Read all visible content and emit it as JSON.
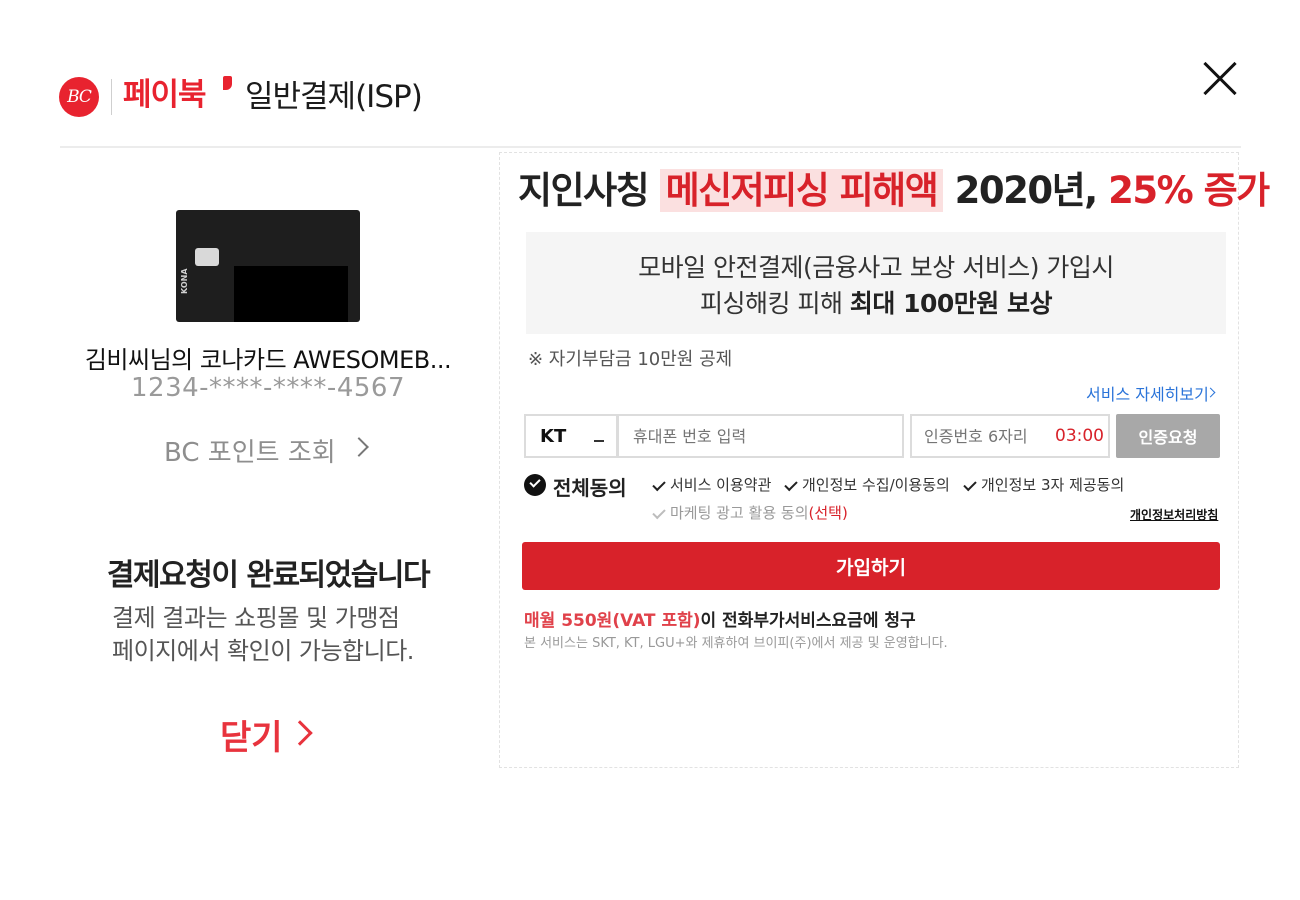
{
  "header": {
    "logo_text": "BC",
    "brand": "페이북",
    "title": "일반결제(ISP)"
  },
  "left": {
    "card_brand_text": "KONA",
    "card_name": "김비씨님의 코나카드 AWESOMEB...",
    "card_number": "1234-****-****-4567",
    "bc_point": "BC 포인트 조회",
    "done_title": "결제요청이 완료되었습니다",
    "done_desc_line1": "결제 결과는 쇼핑몰 및 가맹점",
    "done_desc_line2": "페이지에서 확인이 가능합니다.",
    "close_link": "닫기"
  },
  "ad": {
    "headline_prefix": "지인사칭",
    "headline_highlight": "메신저피싱 피해액",
    "headline_mid": "2020년,",
    "headline_red": "25% 증가",
    "benefit_line1": "모바일 안전결제(금융사고 보상 서비스) 가입시",
    "benefit_line2_prefix": "피싱해킹 피해",
    "benefit_line2_bold": "최대 100만원 보상",
    "deductible": "※ 자기부담금 10만원 공제",
    "detail_link": "서비스 자세히보기",
    "carrier": "KT",
    "phone_placeholder": "휴대폰 번호 입력",
    "auth_placeholder": "인증번호 6자리",
    "timer": "03:00",
    "auth_button": "인증요청",
    "agree_all": "전체동의",
    "term1": "서비스 이용약관",
    "term2": "개인정보 수집/이용동의",
    "term3": "개인정보 3자 제공동의",
    "marketing": "마케팅 광고 활용 동의",
    "marketing_optional": "(선택)",
    "privacy_policy": "개인정보처리방침",
    "join_button": "가입하기",
    "fee_red": "매월 550원(VAT 포함)",
    "fee_rest": "이 전화부가서비스요금에 청구",
    "fee_note": "본 서비스는 SKT, KT, LGU+와 제휴하여 브이피(주)에서 제공 및 운영합니다."
  },
  "colors": {
    "brand_red": "#e8232f",
    "button_red": "#d8222a",
    "link_blue": "#2b74d9"
  }
}
